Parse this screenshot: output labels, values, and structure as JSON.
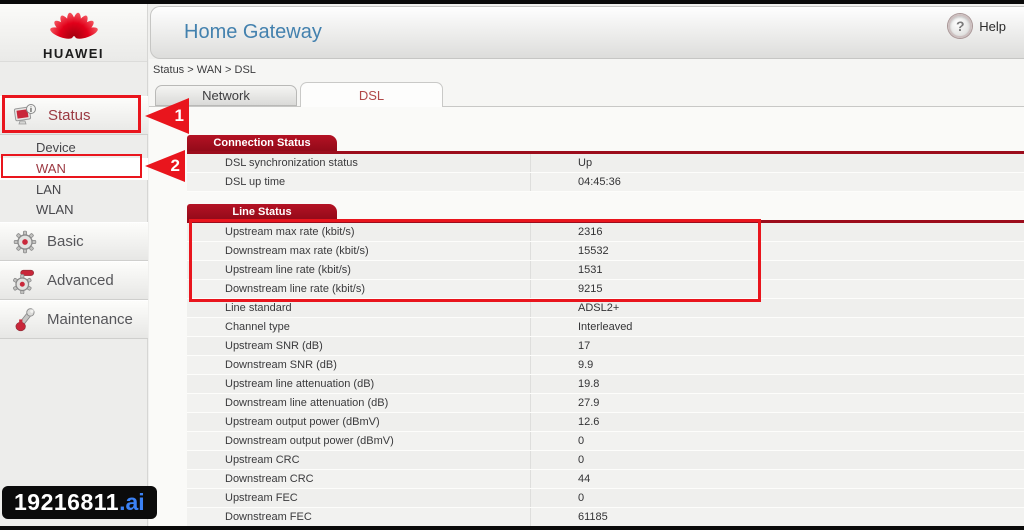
{
  "logo": {
    "brand": "HUAWEI"
  },
  "header": {
    "title": "Home Gateway",
    "help_label": "Help",
    "help_glyph": "?"
  },
  "breadcrumb": "Status > WAN > DSL",
  "tabs": [
    {
      "label": "Network",
      "active": false
    },
    {
      "label": "DSL",
      "active": true
    }
  ],
  "sidebar": {
    "sections": [
      {
        "label": "Status",
        "icon": "status-monitor-icon",
        "selected": true,
        "children": [
          {
            "label": "Device",
            "selected": false
          },
          {
            "label": "WAN",
            "selected": true
          },
          {
            "label": "LAN",
            "selected": false
          },
          {
            "label": "WLAN",
            "selected": false
          }
        ]
      },
      {
        "label": "Basic",
        "icon": "gear-icon"
      },
      {
        "label": "Advanced",
        "icon": "gears-icon"
      },
      {
        "label": "Maintenance",
        "icon": "wrench-icon"
      }
    ]
  },
  "connection_status": {
    "title": "Connection Status",
    "rows": [
      [
        "DSL synchronization status",
        "Up"
      ],
      [
        "DSL up time",
        "04:45:36"
      ]
    ]
  },
  "line_status": {
    "title": "Line Status",
    "rows": [
      [
        "Upstream max rate (kbit/s)",
        "2316"
      ],
      [
        "Downstream max rate (kbit/s)",
        "15532"
      ],
      [
        "Upstream line rate (kbit/s)",
        "1531"
      ],
      [
        "Downstream line rate (kbit/s)",
        "9215"
      ],
      [
        "Line standard",
        "ADSL2+"
      ],
      [
        "Channel type",
        "Interleaved"
      ],
      [
        "Upstream SNR (dB)",
        "17"
      ],
      [
        "Downstream SNR (dB)",
        "9.9"
      ],
      [
        "Upstream line attenuation (dB)",
        "19.8"
      ],
      [
        "Downstream line attenuation (dB)",
        "27.9"
      ],
      [
        "Upstream output power (dBmV)",
        "12.6"
      ],
      [
        "Downstream output power (dBmV)",
        "0"
      ],
      [
        "Upstream CRC",
        "0"
      ],
      [
        "Downstream CRC",
        "44"
      ],
      [
        "Upstream FEC",
        "0"
      ],
      [
        "Downstream FEC",
        "61185"
      ]
    ]
  },
  "annotations": {
    "step1": "1",
    "step2": "2"
  },
  "watermark": {
    "text": "19216811",
    "suffix": ".ai"
  },
  "colors": {
    "annotation_red": "#e9151d",
    "section_header_red": "#9c0c1c",
    "title_blue": "#4381ae",
    "watermark_link_blue": "#3b82f6",
    "selected_item_red": "#9b3740"
  }
}
